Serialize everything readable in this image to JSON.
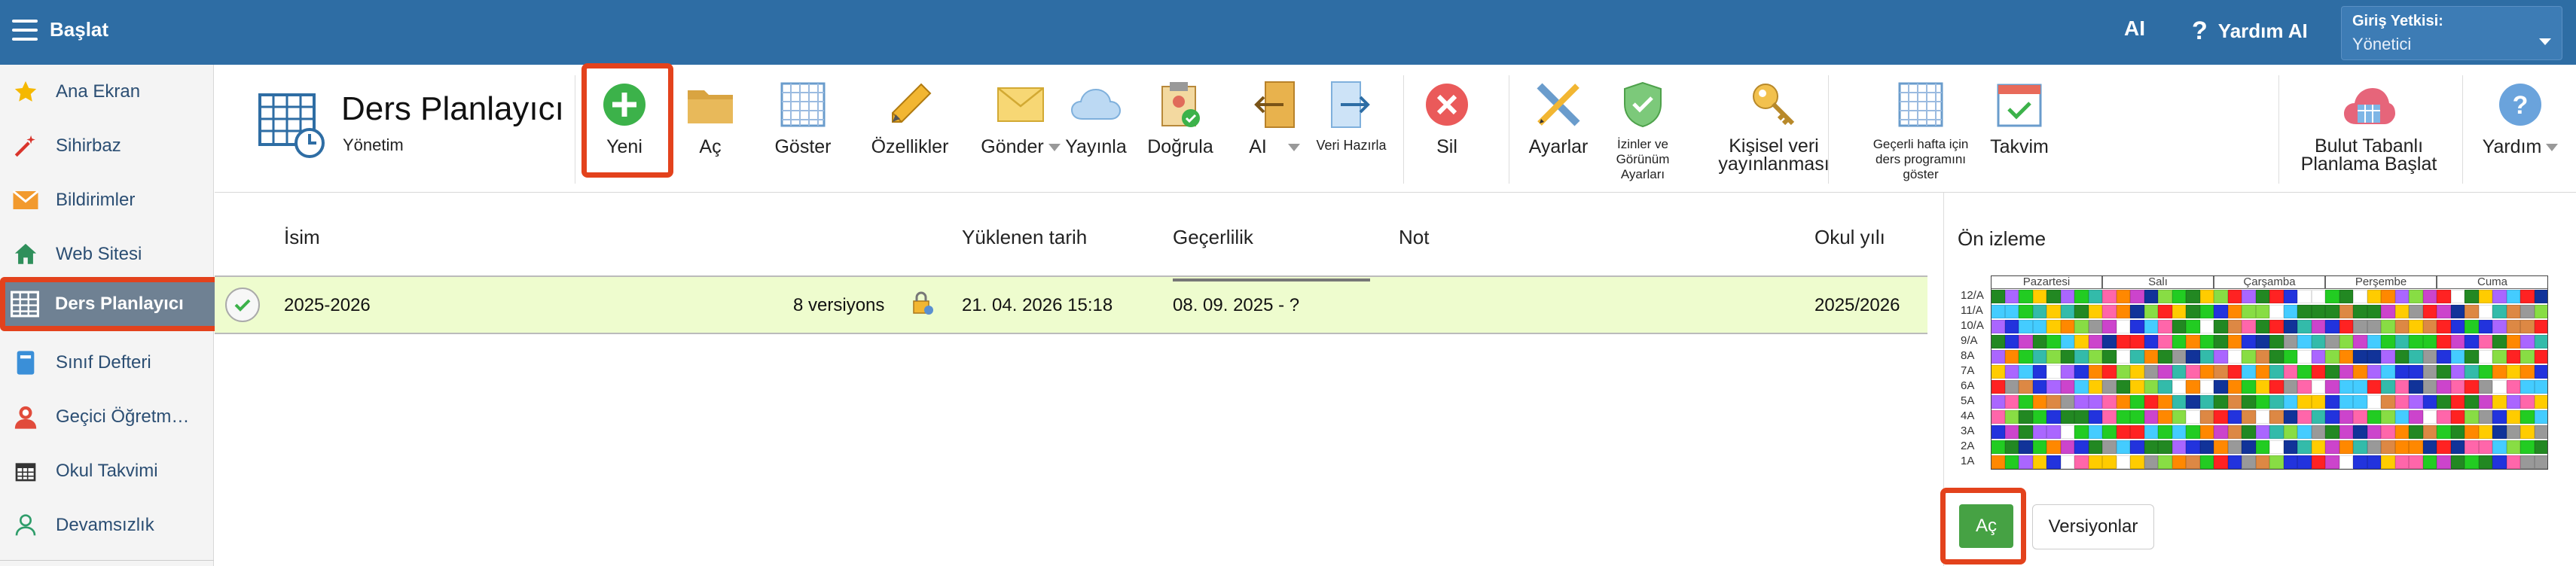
{
  "header": {
    "app_title": "Başlat",
    "ai_label": "AI",
    "help_label": "Yardım AI",
    "login_label": "Giriş Yetkisi:",
    "login_value": "Yönetici"
  },
  "sidebar": {
    "items": [
      {
        "label": "Ana Ekran",
        "icon": "star-icon"
      },
      {
        "label": "Sihirbaz",
        "icon": "magic-wand-icon"
      },
      {
        "label": "Bildirimler",
        "icon": "envelope-icon"
      },
      {
        "label": "Web Sitesi",
        "icon": "home-icon"
      },
      {
        "label": "Ders Planlayıcı",
        "icon": "timetable-icon",
        "active": true
      },
      {
        "label": "Sınıf Defteri",
        "icon": "notebook-icon"
      },
      {
        "label": "Geçici Öğretm…",
        "icon": "teacher-icon"
      },
      {
        "label": "Okul Takvimi",
        "icon": "calendar-icon"
      },
      {
        "label": "Devamsızlık",
        "icon": "person-icon"
      }
    ]
  },
  "module": {
    "title": "Ders Planlayıcı",
    "subtitle": "Yönetim"
  },
  "toolbar": {
    "new": "Yeni",
    "open": "Aç",
    "show": "Göster",
    "properties": "Özellikler",
    "send": "Gönder",
    "publish": "Yayınla",
    "verify": "Doğrula",
    "ai": "AI",
    "data_prep": "Veri Hazırla",
    "delete": "Sil",
    "settings": "Ayarlar",
    "permissions": "İzinler ve Görünüm Ayarları",
    "personal_publish": "Kişisel veri yayınlanması",
    "current_week": "Geçerli hafta için ders programını göster",
    "calendar": "Takvim",
    "cloud_planning": "Bulut Tabanlı Planlama Başlat",
    "help": "Yardım"
  },
  "table": {
    "columns": {
      "name": "İsim",
      "uploaded": "Yüklenen tarih",
      "validity": "Geçerlilik",
      "note": "Not",
      "school_year": "Okul yılı"
    },
    "rows": [
      {
        "name": "2025-2026",
        "versions": "8 versiyons",
        "uploaded": "21. 04. 2026 15:18",
        "validity": "08. 09. 2025 - ?",
        "note": "",
        "school_year": "2025/2026"
      }
    ]
  },
  "preview": {
    "title": "Ön izleme",
    "days": [
      "Pazartesi",
      "Salı",
      "Çarşamba",
      "Perşembe",
      "Cuma"
    ],
    "classes": [
      "12/A",
      "11/A",
      "10/A",
      "9/A",
      "8A",
      "7A",
      "6A",
      "5A",
      "4A",
      "3A",
      "2A",
      "1A"
    ],
    "open_button": "Aç",
    "versions_button": "Versiyonlar"
  },
  "colors": {
    "topbar": "#2e6da4",
    "highlight": "#e3421c",
    "row_bg": "#eefcce",
    "open_button": "#46a244"
  }
}
